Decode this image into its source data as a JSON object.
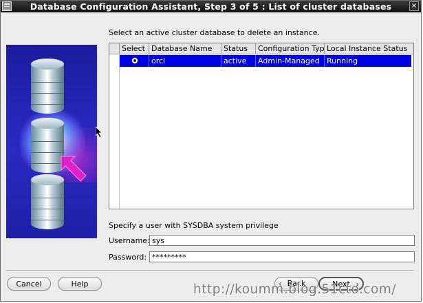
{
  "window": {
    "title": "Database Configuration Assistant, Step 3 of 5 : List of cluster databases",
    "close_glyph": "×"
  },
  "main": {
    "instruction": "Select an active cluster database to delete an instance.",
    "table": {
      "columns": [
        "Select",
        "Database Name",
        "Status",
        "Configuration Type",
        "Local Instance Status"
      ],
      "rows": [
        {
          "selected": true,
          "database_name": "orcl",
          "status": "active",
          "configuration_type": "Admin-Managed",
          "local_instance_status": "Running"
        }
      ]
    },
    "credentials": {
      "label": "Specify a user with SYSDBA system privilege",
      "username_label": "Username:",
      "username_value": "sys",
      "password_label": "Password:",
      "password_value": "*********"
    }
  },
  "buttons": {
    "cancel": "Cancel",
    "help": "Help",
    "back": "Back",
    "next": "Next"
  },
  "watermark": "http://koumm.blog.51cto.com/",
  "colors": {
    "selection": "#0000e6",
    "side_panel": "#2a2ac2",
    "arrow": "#e020c8"
  }
}
